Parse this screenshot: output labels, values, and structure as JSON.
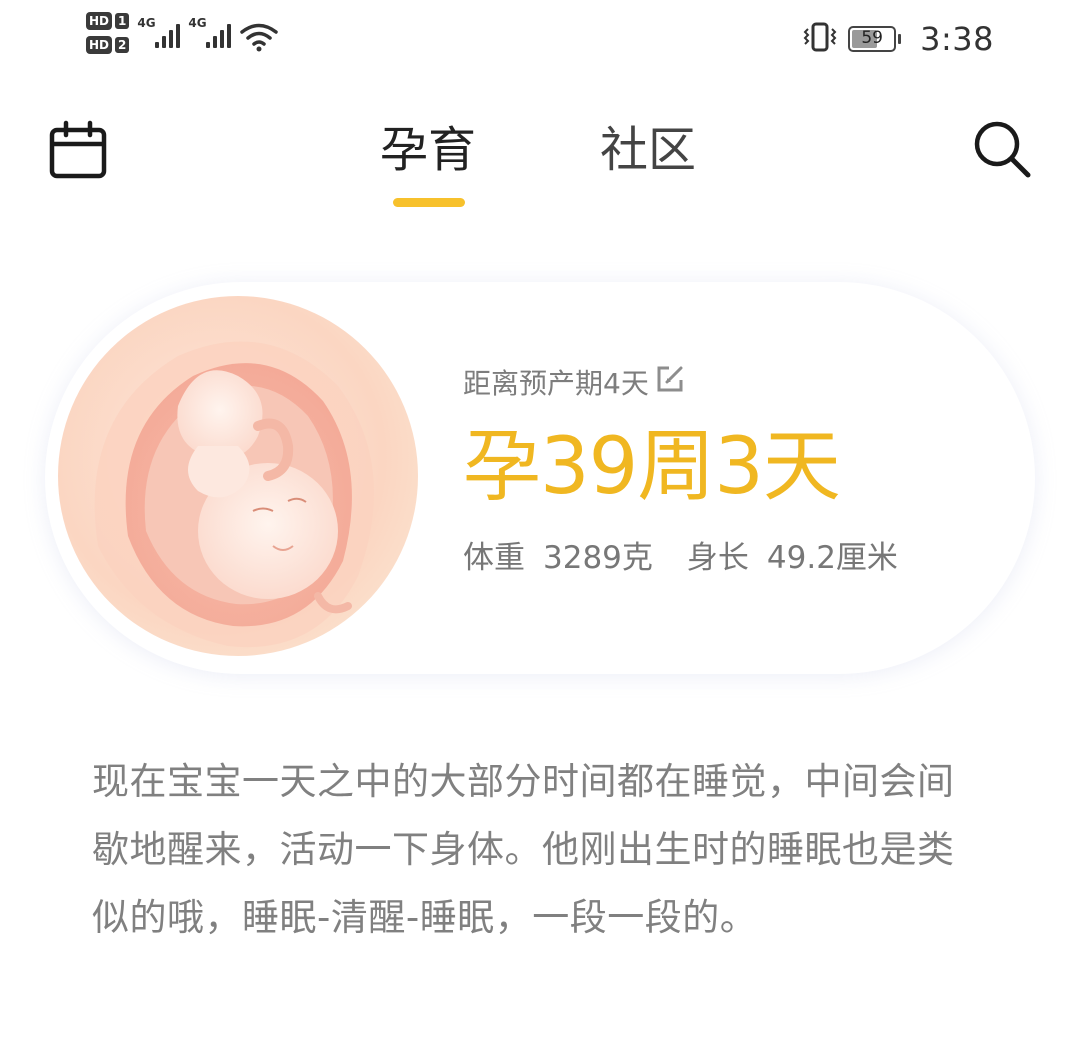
{
  "status_bar": {
    "sim1_label": "HD",
    "sim1_num": "1",
    "sim2_label": "HD",
    "sim2_num": "2",
    "network1": "4G",
    "network2": "4G",
    "battery_level": "59",
    "time": "3:38"
  },
  "nav": {
    "tabs": [
      {
        "label": "孕育",
        "active": true
      },
      {
        "label": "社区",
        "active": false
      }
    ],
    "left_icon": "calendar-icon",
    "right_icon": "search-icon",
    "accent_color": "#f7c12c"
  },
  "card": {
    "due_text": "距离预产期4天",
    "week_text": "孕39周3天",
    "weight_label": "体重",
    "weight_value": "3289克",
    "length_label": "身长",
    "length_value": "49.2厘米",
    "illustration": "fetus-illustration",
    "highlight_color": "#f0b721"
  },
  "description": "现在宝宝一天之中的大部分时间都在睡觉，中间会间歇地醒来，活动一下身体。他刚出生时的睡眠也是类似的哦，睡眠-清醒-睡眠，一段一段的。"
}
